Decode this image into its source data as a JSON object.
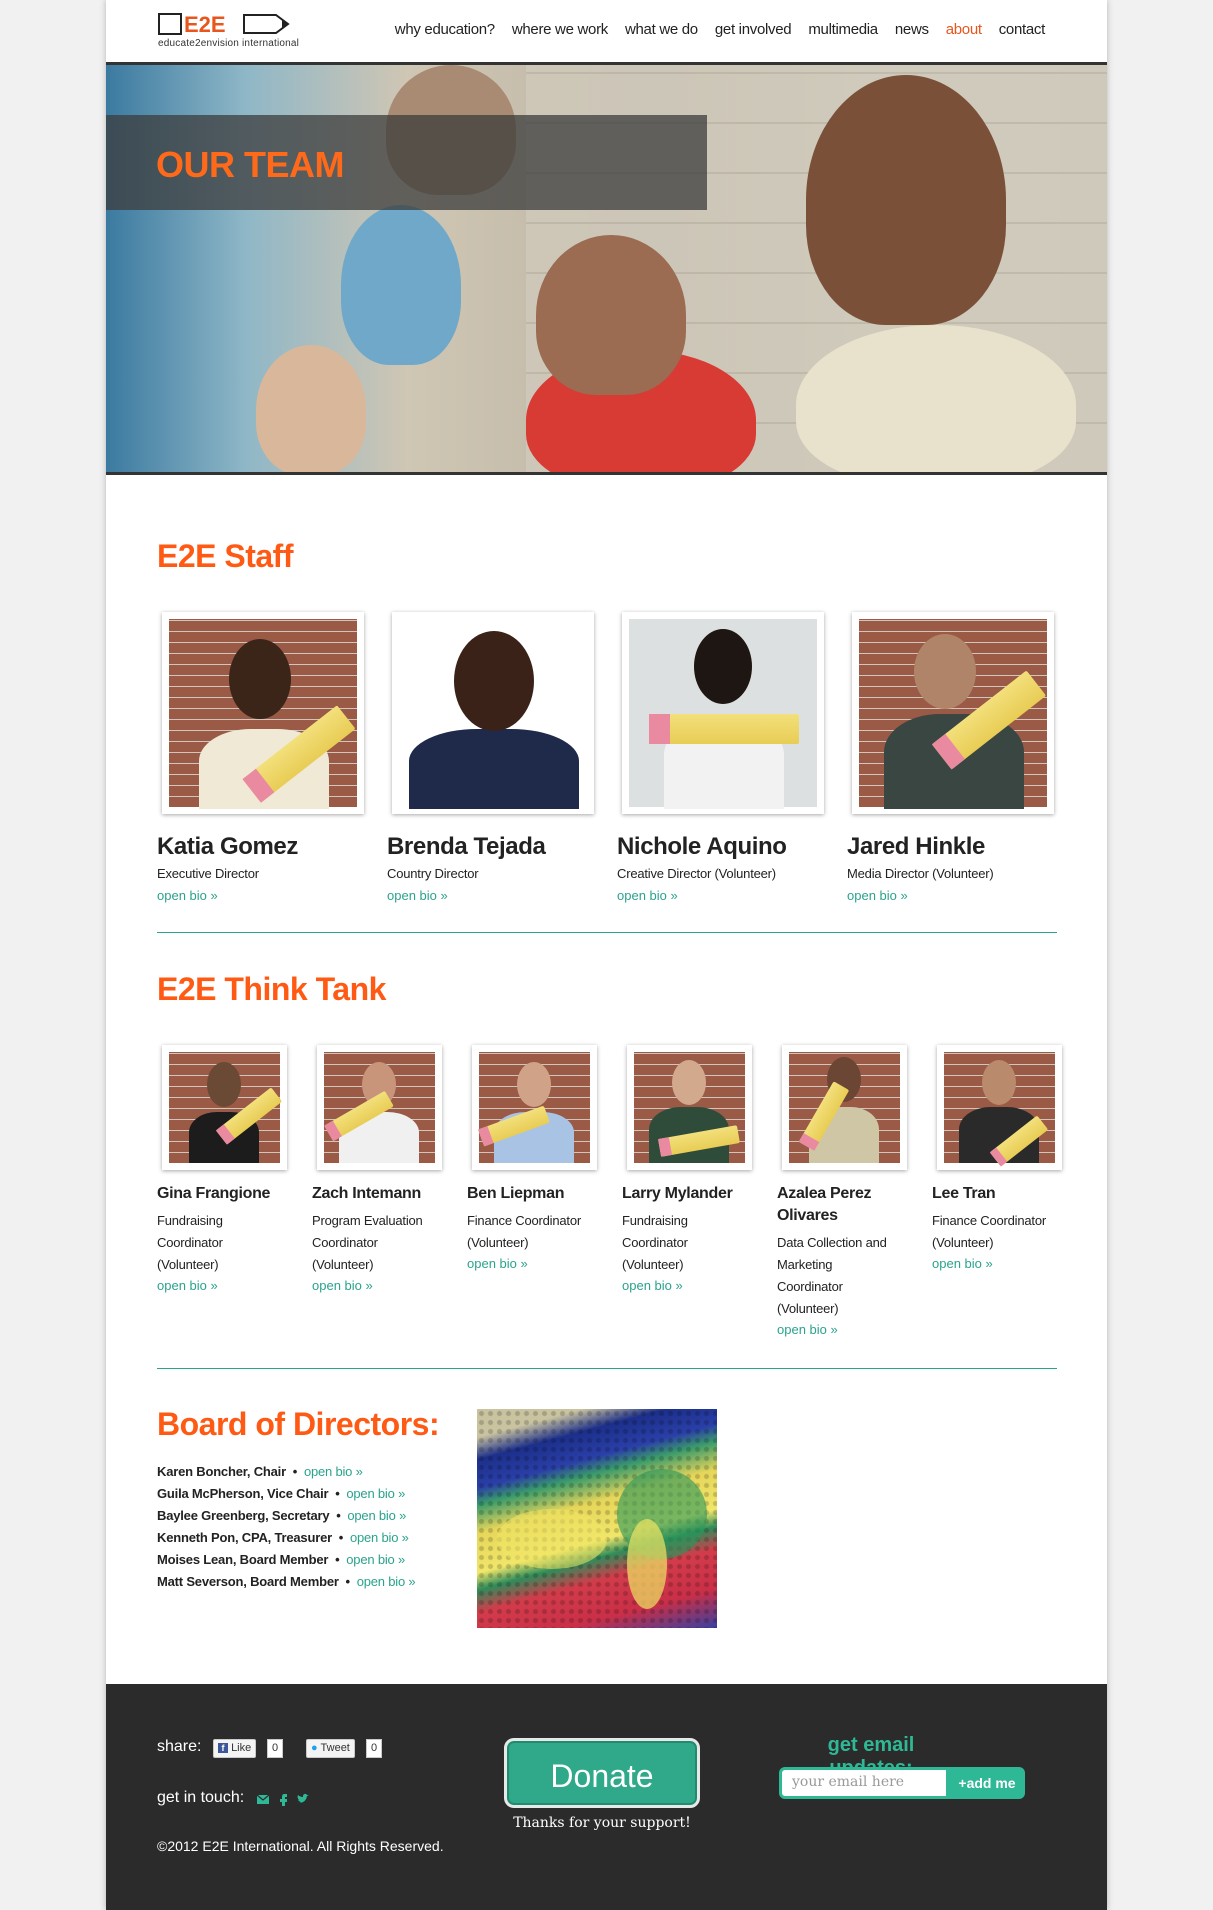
{
  "nav": {
    "logo_tagline": "educate2envision international",
    "items": [
      "why education?",
      "where we work",
      "what we do",
      "get involved",
      "multimedia",
      "news",
      "about",
      "contact"
    ],
    "active": "about"
  },
  "hero": {
    "title": "OUR TEAM"
  },
  "staff": {
    "heading": "E2E Staff",
    "members": [
      {
        "name": "Katia Gomez",
        "role": "Executive Director",
        "bio": "open bio »"
      },
      {
        "name": "Brenda Tejada",
        "role": "Country Director",
        "bio": "open bio »"
      },
      {
        "name": "Nichole Aquino",
        "role": "Creative Director (Volunteer)",
        "bio": "open bio »"
      },
      {
        "name": "Jared Hinkle",
        "role": "Media Director (Volunteer)",
        "bio": "open bio »"
      }
    ]
  },
  "think_tank": {
    "heading": "E2E Think Tank",
    "members": [
      {
        "name": "Gina Frangione",
        "role": [
          "Fundraising",
          "Coordinator",
          "(Volunteer)"
        ],
        "bio": "open bio »"
      },
      {
        "name": "Zach Intemann",
        "role": [
          "Program Evaluation",
          "Coordinator",
          "(Volunteer)"
        ],
        "bio": "open bio »"
      },
      {
        "name": "Ben Liepman",
        "role": [
          "Finance Coordinator",
          "(Volunteer)"
        ],
        "bio": "open bio »"
      },
      {
        "name": "Larry Mylander",
        "role": [
          "Fundraising",
          "Coordinator",
          "(Volunteer)"
        ],
        "bio": "open bio »"
      },
      {
        "name_lines": [
          "Azalea Perez",
          "Olivares"
        ],
        "role": [
          "Data Collection and",
          "Marketing",
          "Coordinator",
          "(Volunteer)"
        ],
        "bio": "open bio »"
      },
      {
        "name": "Lee Tran",
        "role": [
          "Finance Coordinator",
          "(Volunteer)"
        ],
        "bio": "open bio »"
      }
    ]
  },
  "board": {
    "heading": "Board of Directors:",
    "bio_label": "open bio »",
    "members": [
      "Karen Boncher, Chair",
      "Guila McPherson, Vice Chair",
      "Baylee Greenberg, Secretary",
      "Kenneth Pon, CPA, Treasurer",
      "Moises Lean, Board Member",
      "Matt Severson, Board Member"
    ]
  },
  "footer": {
    "share_label": "share:",
    "like_label": "Like",
    "like_count": "0",
    "tweet_label": "Tweet",
    "tweet_count": "0",
    "touch_label": "get in touch:",
    "copyright": "©2012 E2E International. All Rights Reserved.",
    "donate_label": "Donate",
    "thanks": "Thanks for your support!",
    "updates_label": "get email updates:",
    "email_placeholder": "your email here",
    "add_label": "+add me"
  },
  "colors": {
    "accent": "#ff5a14",
    "teal": "#2aa38d",
    "footer_bg": "#2b2b2b"
  }
}
